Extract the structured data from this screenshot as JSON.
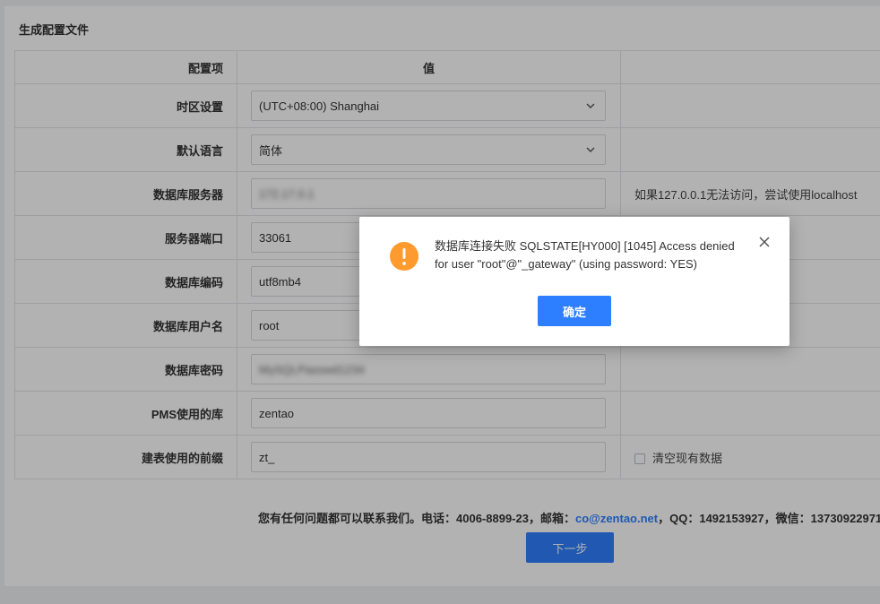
{
  "panel": {
    "title": "生成配置文件"
  },
  "table": {
    "headers": [
      "配置项",
      "值",
      ""
    ],
    "rows": [
      {
        "label": "时区设置",
        "value": "(UTC+08:00) Shanghai",
        "type": "select",
        "hint": ""
      },
      {
        "label": "默认语言",
        "value": "简体",
        "type": "select",
        "hint": ""
      },
      {
        "label": "数据库服务器",
        "value": "172.17.0.1",
        "type": "input-blurred",
        "hint": "如果127.0.0.1无法访问，尝试使用localhost"
      },
      {
        "label": "服务器端口",
        "value": "33061",
        "type": "input",
        "hint": ""
      },
      {
        "label": "数据库编码",
        "value": "utf8mb4",
        "type": "input",
        "hint": ""
      },
      {
        "label": "数据库用户名",
        "value": "root",
        "type": "input",
        "hint": ""
      },
      {
        "label": "数据库密码",
        "value": "MySQLPasswd1234",
        "type": "input-blurred",
        "hint": ""
      },
      {
        "label": "PMS使用的库",
        "value": "zentao",
        "type": "input",
        "hint": ""
      },
      {
        "label": "建表使用的前缀",
        "value": "zt_",
        "type": "input",
        "hint": "清空现有数据",
        "hint_checkbox": true
      }
    ]
  },
  "footer": {
    "contact_prefix": "您有任何问题都可以联系我们。电话：4006-8899-23，邮箱：",
    "email": "co@zentao.net",
    "contact_suffix": "，QQ：1492153927，微信：13730922971",
    "next_label": "下一步"
  },
  "dialog": {
    "message": "数据库连接失败 SQLSTATE[HY000] [1045] Access denied for user \"root\"@\"_gateway\" (using password: YES)",
    "ok_label": "确定",
    "icon": "warning-icon",
    "icon_color": "#ff9a2e",
    "accent_color": "#2e7fff"
  }
}
